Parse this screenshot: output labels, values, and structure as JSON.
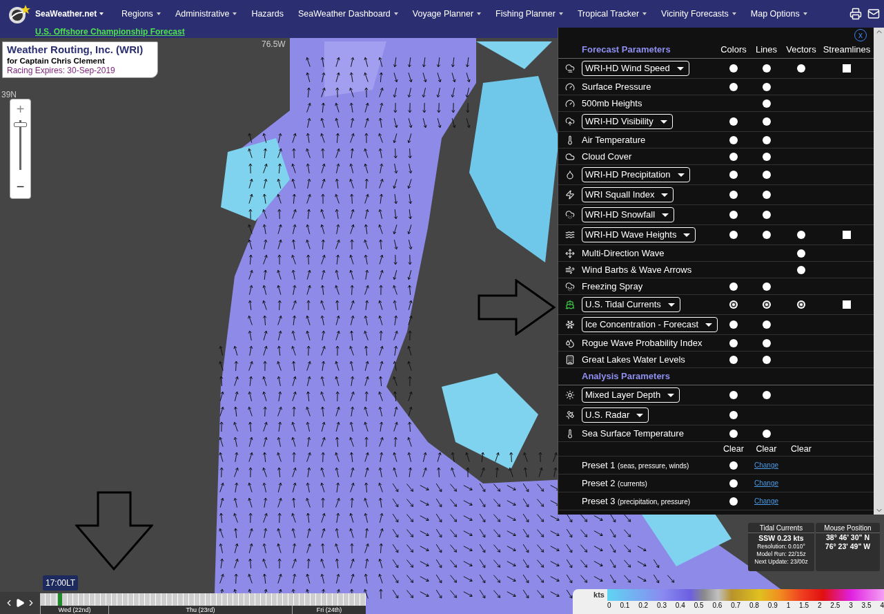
{
  "nav": {
    "brand": "SeaWeather.net",
    "brand_dropdown": true,
    "sublink": "U.S. Offshore Championship Forecast",
    "menu": [
      {
        "label": "Regions",
        "dropdown": true
      },
      {
        "label": "Administrative",
        "dropdown": true
      },
      {
        "label": "Hazards",
        "dropdown": false
      },
      {
        "label": "SeaWeather Dashboard",
        "dropdown": true
      },
      {
        "label": "Voyage Planner",
        "dropdown": true
      },
      {
        "label": "Fishing Planner",
        "dropdown": true
      },
      {
        "label": "Tropical Tracker",
        "dropdown": true
      },
      {
        "label": "Vicinity Forecasts",
        "dropdown": true
      },
      {
        "label": "Map Options",
        "dropdown": true
      }
    ]
  },
  "info_card": {
    "title": "Weather Routing, Inc. (WRI)",
    "subtitle": "for Captain Chris Clement",
    "expiry": "Racing Expires: 30-Sep-2019"
  },
  "map": {
    "longitude_label": "76.5W",
    "latitude_label": "39N"
  },
  "zoom": {
    "plus": "+",
    "minus": "−",
    "level": 0.95
  },
  "parameters_panel": {
    "close": "x",
    "columns": [
      "Colors",
      "Lines",
      "Vectors",
      "Streamlines"
    ],
    "sections": [
      {
        "title": "Forecast Parameters",
        "rows": [
          {
            "kind": "dropdown",
            "label": "WRI-HD Wind Speed",
            "cells": [
              {
                "kind": "radio",
                "selected": false
              },
              {
                "kind": "radio",
                "selected": false
              },
              {
                "kind": "radio",
                "selected": false
              },
              {
                "kind": "checkbox",
                "checked": false
              }
            ]
          },
          {
            "kind": "label",
            "label": "Surface Pressure",
            "cells": [
              {
                "kind": "radio",
                "selected": false
              },
              {
                "kind": "radio",
                "selected": false
              },
              {
                "kind": "none"
              },
              {
                "kind": "none"
              }
            ]
          },
          {
            "kind": "label",
            "label": "500mb Heights",
            "cells": [
              {
                "kind": "none"
              },
              {
                "kind": "radio",
                "selected": false
              },
              {
                "kind": "none"
              },
              {
                "kind": "none"
              }
            ]
          },
          {
            "kind": "dropdown",
            "label": "WRI-HD Visibility",
            "cells": [
              {
                "kind": "radio",
                "selected": false
              },
              {
                "kind": "radio",
                "selected": false
              },
              {
                "kind": "none"
              },
              {
                "kind": "none"
              }
            ]
          },
          {
            "kind": "label",
            "label": "Air Temperature",
            "cells": [
              {
                "kind": "radio",
                "selected": false
              },
              {
                "kind": "radio",
                "selected": false
              },
              {
                "kind": "none"
              },
              {
                "kind": "none"
              }
            ]
          },
          {
            "kind": "label",
            "label": "Cloud Cover",
            "cells": [
              {
                "kind": "radio",
                "selected": false
              },
              {
                "kind": "radio",
                "selected": false
              },
              {
                "kind": "none"
              },
              {
                "kind": "none"
              }
            ]
          },
          {
            "kind": "dropdown",
            "label": "WRI-HD Precipitation",
            "cells": [
              {
                "kind": "radio",
                "selected": false
              },
              {
                "kind": "radio",
                "selected": false
              },
              {
                "kind": "none"
              },
              {
                "kind": "none"
              }
            ]
          },
          {
            "kind": "dropdown",
            "label": "WRI Squall Index",
            "cells": [
              {
                "kind": "radio",
                "selected": false
              },
              {
                "kind": "radio",
                "selected": false
              },
              {
                "kind": "none"
              },
              {
                "kind": "none"
              }
            ]
          },
          {
            "kind": "dropdown",
            "label": "WRI-HD Snowfall",
            "cells": [
              {
                "kind": "radio",
                "selected": false
              },
              {
                "kind": "radio",
                "selected": false
              },
              {
                "kind": "none"
              },
              {
                "kind": "none"
              }
            ]
          },
          {
            "kind": "dropdown",
            "label": "WRI-HD Wave Heights",
            "cells": [
              {
                "kind": "radio",
                "selected": false
              },
              {
                "kind": "radio",
                "selected": false
              },
              {
                "kind": "radio",
                "selected": false
              },
              {
                "kind": "checkbox",
                "checked": false
              }
            ]
          },
          {
            "kind": "label",
            "label": "Multi-Direction Wave",
            "cells": [
              {
                "kind": "none"
              },
              {
                "kind": "none"
              },
              {
                "kind": "radio",
                "selected": false
              },
              {
                "kind": "none"
              }
            ]
          },
          {
            "kind": "label",
            "label": "Wind Barbs & Wave Arrows",
            "cells": [
              {
                "kind": "none"
              },
              {
                "kind": "none"
              },
              {
                "kind": "radio",
                "selected": false
              },
              {
                "kind": "none"
              }
            ]
          },
          {
            "kind": "label",
            "label": "Freezing Spray",
            "cells": [
              {
                "kind": "radio",
                "selected": false
              },
              {
                "kind": "radio",
                "selected": false
              },
              {
                "kind": "none"
              },
              {
                "kind": "none"
              }
            ]
          },
          {
            "kind": "dropdown",
            "label": "U.S. Tidal Currents",
            "cells": [
              {
                "kind": "radio",
                "selected": true
              },
              {
                "kind": "radio",
                "selected": true
              },
              {
                "kind": "radio",
                "selected": true
              },
              {
                "kind": "checkbox",
                "checked": false
              }
            ]
          },
          {
            "kind": "dropdown",
            "label": "Ice Concentration - Forecast",
            "cells": [
              {
                "kind": "radio",
                "selected": false
              },
              {
                "kind": "radio",
                "selected": false
              },
              {
                "kind": "none"
              },
              {
                "kind": "none"
              }
            ]
          },
          {
            "kind": "label",
            "label": "Rogue Wave Probability Index",
            "cells": [
              {
                "kind": "radio",
                "selected": false
              },
              {
                "kind": "radio",
                "selected": false
              },
              {
                "kind": "none"
              },
              {
                "kind": "none"
              }
            ]
          },
          {
            "kind": "label",
            "label": "Great Lakes Water Levels",
            "cells": [
              {
                "kind": "radio",
                "selected": false
              },
              {
                "kind": "radio",
                "selected": false
              },
              {
                "kind": "none"
              },
              {
                "kind": "none"
              }
            ]
          }
        ]
      },
      {
        "title": "Analysis Parameters",
        "rows": [
          {
            "kind": "dropdown",
            "label": "Mixed Layer Depth",
            "cells": [
              {
                "kind": "radio",
                "selected": false
              },
              {
                "kind": "radio",
                "selected": false
              },
              {
                "kind": "none"
              },
              {
                "kind": "none"
              }
            ]
          },
          {
            "kind": "dropdown",
            "label": "U.S. Radar",
            "cells": [
              {
                "kind": "radio",
                "selected": false
              },
              {
                "kind": "none"
              },
              {
                "kind": "none"
              },
              {
                "kind": "none"
              }
            ]
          },
          {
            "kind": "label",
            "label": "Sea Surface Temperature",
            "cells": [
              {
                "kind": "radio",
                "selected": false
              },
              {
                "kind": "radio",
                "selected": false
              },
              {
                "kind": "none"
              },
              {
                "kind": "none"
              }
            ]
          }
        ]
      }
    ],
    "clear_labels": [
      "Clear",
      "Clear",
      "Clear"
    ],
    "presets": [
      {
        "name": "Preset 1",
        "note": "(seas, pressure, winds)",
        "selected": false,
        "link": "Change"
      },
      {
        "name": "Preset 2",
        "note": "(currents)",
        "selected": false,
        "link": "Change"
      },
      {
        "name": "Preset 3",
        "note": "(precipitation, pressure)",
        "selected": false,
        "link": "Change"
      }
    ]
  },
  "tidal_info": {
    "title": "Tidal Currents",
    "value": "SSW 0.23 kts",
    "lines": [
      "Resolution: 0.010°",
      "Model Run: 22/15z",
      "Next Update: 23/00z"
    ]
  },
  "mouse_position": {
    "title": "Mouse Position",
    "lat": "38° 46' 30\" N",
    "lon": "76° 23' 49\" W"
  },
  "timeline": {
    "time": "17:00LT",
    "level": 0.055,
    "days": [
      "Wed (22nd)",
      "Thu (23rd)",
      "Fri (24th)"
    ]
  },
  "legend": {
    "unit": "kts",
    "ticks": [
      "0",
      "0.1",
      "0.2",
      "0.3",
      "0.4",
      "0.5",
      "0.6",
      "0.7",
      "0.8",
      "0.9",
      "1",
      "1.5",
      "2",
      "2.5",
      "3",
      "3.5",
      "4"
    ]
  }
}
